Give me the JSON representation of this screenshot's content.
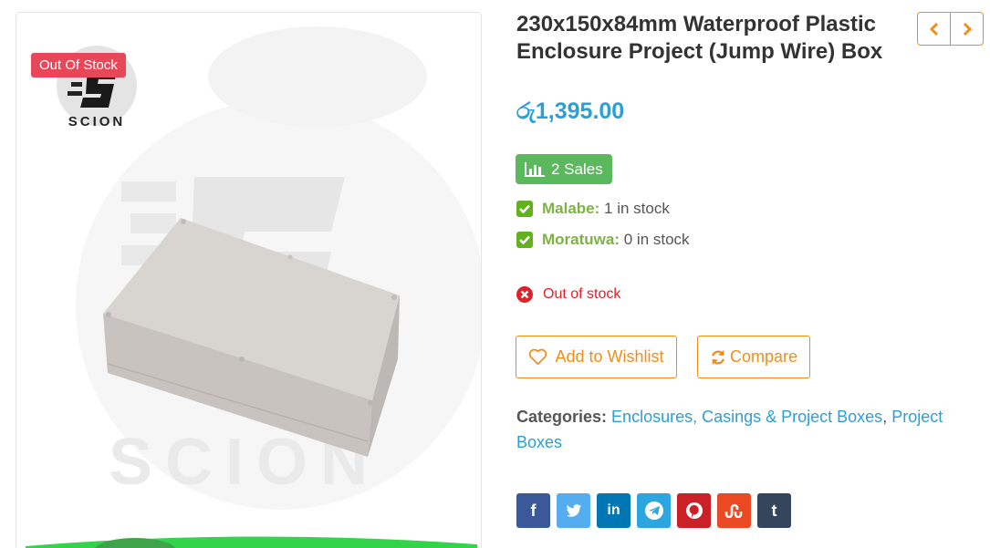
{
  "product": {
    "badge": "Out Of Stock",
    "logo_text": "SCION",
    "watermark_text": "SCION",
    "title": "230x150x84mm Waterproof Plastic Enclosure Project (Jump Wire) Box",
    "price": "රු1,395.00",
    "sales": "2 Sales"
  },
  "stock": [
    {
      "location": "Malabe:",
      "qty": "1 in stock"
    },
    {
      "location": "Moratuwa:",
      "qty": "0 in stock"
    }
  ],
  "availability": "Out of stock",
  "actions": {
    "wishlist": "Add to Wishlist",
    "compare": "Compare"
  },
  "categories": {
    "label": "Categories:",
    "items": [
      "Enclosures, Casings & Project Boxes",
      "Project Boxes"
    ],
    "separator": ", "
  },
  "share": [
    {
      "name": "facebook",
      "icon": "f",
      "color": "#3b5998"
    },
    {
      "name": "twitter",
      "icon": "twitter-bird-icon",
      "color": "#55acee"
    },
    {
      "name": "linkedin",
      "icon": "in",
      "color": "#0077b5"
    },
    {
      "name": "telegram",
      "icon": "telegram-plane-icon",
      "color": "#2ca5e0"
    },
    {
      "name": "pinterest",
      "icon": "pinterest-icon",
      "color": "#cb2027"
    },
    {
      "name": "stumbleupon",
      "icon": "stumbleupon-icon",
      "color": "#eb4924"
    },
    {
      "name": "tumblr",
      "icon": "t",
      "color": "#35465c"
    }
  ],
  "colors": {
    "accent": "#f08e1c",
    "price": "#2b9fd8",
    "sales": "#5cb85c",
    "in_stock": "#62b21e",
    "out_of_stock": "#e0202a",
    "badge": "#e8475a"
  }
}
